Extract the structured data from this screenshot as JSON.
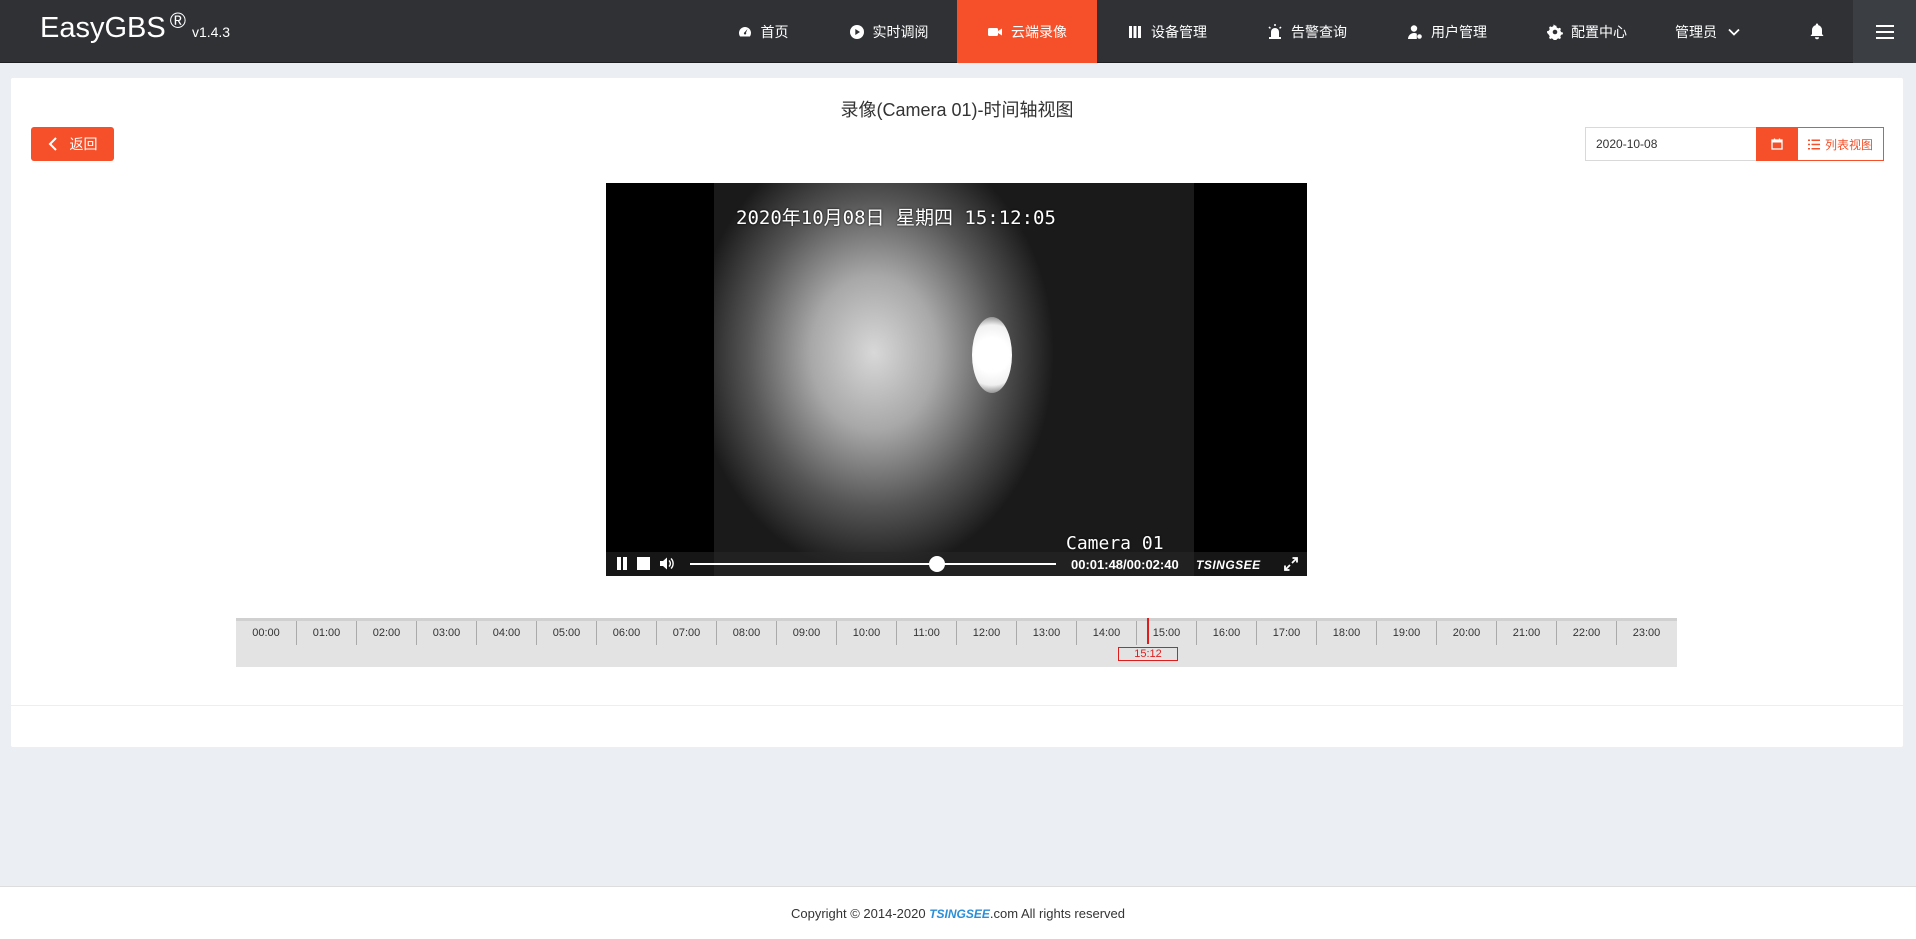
{
  "brand": {
    "name": "EasyGBS",
    "reg": "®",
    "version": "v1.4.3"
  },
  "nav": [
    {
      "label": "首页",
      "icon": "dashboard-icon",
      "active": false
    },
    {
      "label": "实时调阅",
      "icon": "play-circle-icon",
      "active": false
    },
    {
      "label": "云端录像",
      "icon": "video-camera-icon",
      "active": true
    },
    {
      "label": "设备管理",
      "icon": "columns-icon",
      "active": false
    },
    {
      "label": "告警查询",
      "icon": "alarm-icon",
      "active": false
    },
    {
      "label": "用户管理",
      "icon": "user-gear-icon",
      "active": false
    },
    {
      "label": "配置中心",
      "icon": "gear-icon",
      "active": false
    }
  ],
  "user": {
    "label": "管理员",
    "icon": "chevron-down-icon"
  },
  "page": {
    "title": "录像(Camera 01)-时间轴视图",
    "back_label": "返回",
    "date_value": "2020-10-08",
    "list_view_label": "列表视图"
  },
  "video": {
    "osd_datetime": "2020年10月08日  星期四  15:12:05",
    "osd_camera": "Camera 01",
    "time_display": "00:01:48/00:02:40",
    "logo": "TSINGSEE",
    "progress": 0.675
  },
  "timeline": {
    "hours": [
      "00:00",
      "01:00",
      "02:00",
      "03:00",
      "04:00",
      "05:00",
      "06:00",
      "07:00",
      "08:00",
      "09:00",
      "10:00",
      "11:00",
      "12:00",
      "13:00",
      "14:00",
      "15:00",
      "16:00",
      "17:00",
      "18:00",
      "19:00",
      "20:00",
      "21:00",
      "22:00",
      "23:00"
    ],
    "cursor_label": "15:12",
    "cursor_hours": 15.2
  },
  "footer": {
    "prefix": "Copyright © 2014-2020 ",
    "logo": "TSINGSEE",
    "suffix": ".com All rights reserved"
  },
  "colors": {
    "accent": "#f5502a",
    "nav_bg": "#2f3135",
    "cursor": "#e01d1d"
  }
}
